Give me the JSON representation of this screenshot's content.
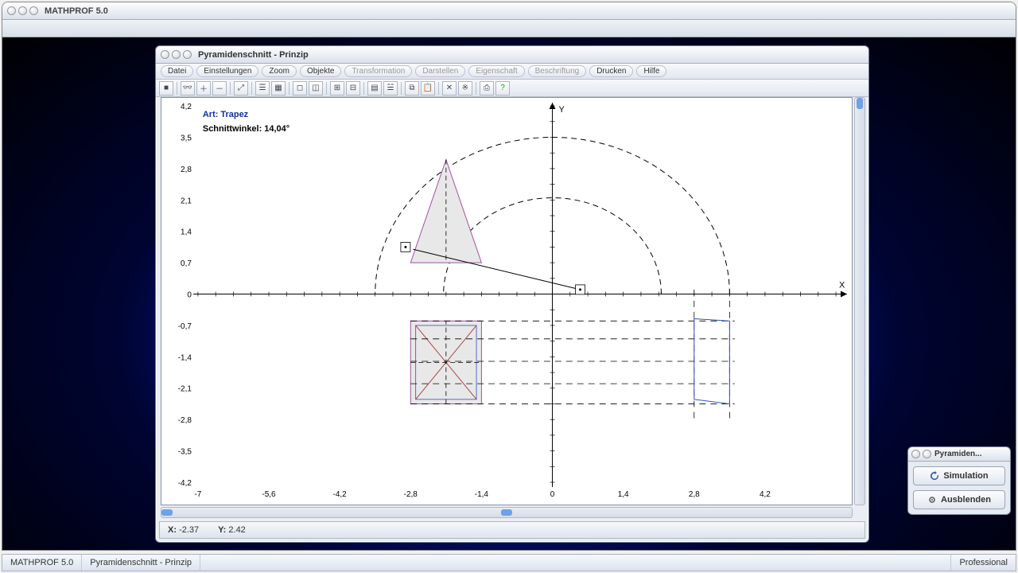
{
  "app": {
    "title": "MATHPROF 5.0"
  },
  "child": {
    "title": "Pyramidenschnitt - Prinzip"
  },
  "menu": {
    "items": [
      {
        "label": "Datei",
        "enabled": true
      },
      {
        "label": "Einstellungen",
        "enabled": true
      },
      {
        "label": "Zoom",
        "enabled": true
      },
      {
        "label": "Objekte",
        "enabled": true
      },
      {
        "label": "Transformation",
        "enabled": false
      },
      {
        "label": "Darstellen",
        "enabled": false
      },
      {
        "label": "Eigenschaft",
        "enabled": false
      },
      {
        "label": "Beschriftung",
        "enabled": false
      },
      {
        "label": "Drucken",
        "enabled": true
      },
      {
        "label": "Hilfe",
        "enabled": true
      }
    ]
  },
  "toolbar": {
    "icons": [
      "stop",
      "binoculars",
      "zoom-in",
      "zoom-out",
      "zoom-fit",
      "props",
      "layout",
      "win1",
      "win2",
      "grid1",
      "grid2",
      "table",
      "cols",
      "copy",
      "clip",
      "x1",
      "x2",
      "print",
      "help"
    ]
  },
  "plot": {
    "art_label": "Art:",
    "art_value": "Trapez",
    "angle_label": "Schnittwinkel:",
    "angle_value": "14,04°",
    "xaxis": "X",
    "yaxis": "Y"
  },
  "chart_data": {
    "type": "diagram",
    "xlim": [
      -7,
      5.6
    ],
    "ylim": [
      -4.2,
      4.2
    ],
    "xticks_labeled": [
      -7,
      -5.6,
      -4.2,
      -2.8,
      -1.4,
      0,
      1.4,
      2.8,
      4.2
    ],
    "yticks_labeled": [
      -4.2,
      -3.5,
      -2.8,
      -2.1,
      -1.4,
      -0.7,
      0,
      0.7,
      1.4,
      2.1,
      2.8,
      3.5,
      4.2
    ],
    "minor_step": 0.35,
    "arcs": [
      {
        "cx": 0,
        "cy": 0,
        "r": 2.15,
        "start_deg": 0,
        "end_deg": 180
      },
      {
        "cx": 0,
        "cy": 0,
        "r": 3.5,
        "start_deg": 0,
        "end_deg": 180
      }
    ],
    "triangle": {
      "apex": [
        -2.1,
        3.0
      ],
      "base_left": [
        -2.8,
        0.7
      ],
      "base_right": [
        -1.4,
        0.7
      ]
    },
    "cut_line": {
      "p1": [
        -2.75,
        1.0
      ],
      "p2": [
        0.55,
        0.1
      ]
    },
    "handles": [
      [
        -2.9,
        1.05
      ],
      [
        0.55,
        0.1
      ]
    ],
    "square": {
      "x": -2.8,
      "y": -2.45,
      "w": 1.4,
      "h": 1.85
    },
    "inner_square": {
      "tl": [
        -2.7,
        -0.7
      ],
      "tr": [
        -1.5,
        -0.7
      ],
      "br": [
        -1.5,
        -2.35
      ],
      "bl": [
        -2.7,
        -2.35
      ]
    },
    "projection_x_lines_y": [
      -0.6,
      -1.0,
      -1.5,
      -2.0,
      -2.45
    ],
    "projection_vertical_x": [
      2.8,
      3.5
    ],
    "right_trapezoid": {
      "p": [
        [
          2.8,
          -0.55
        ],
        [
          3.5,
          -0.6
        ],
        [
          3.5,
          -2.45
        ],
        [
          2.8,
          -2.35
        ]
      ]
    }
  },
  "status": {
    "x_label": "X:",
    "x_value": "-2.37",
    "y_label": "Y:",
    "y_value": "2.42"
  },
  "panel": {
    "title": "Pyramiden...",
    "btn1": "Simulation",
    "btn2": "Ausblenden"
  },
  "outer_status": {
    "cell1": "MATHPROF 5.0",
    "cell2": "Pyramidenschnitt - Prinzip",
    "cell3": "Professional"
  }
}
